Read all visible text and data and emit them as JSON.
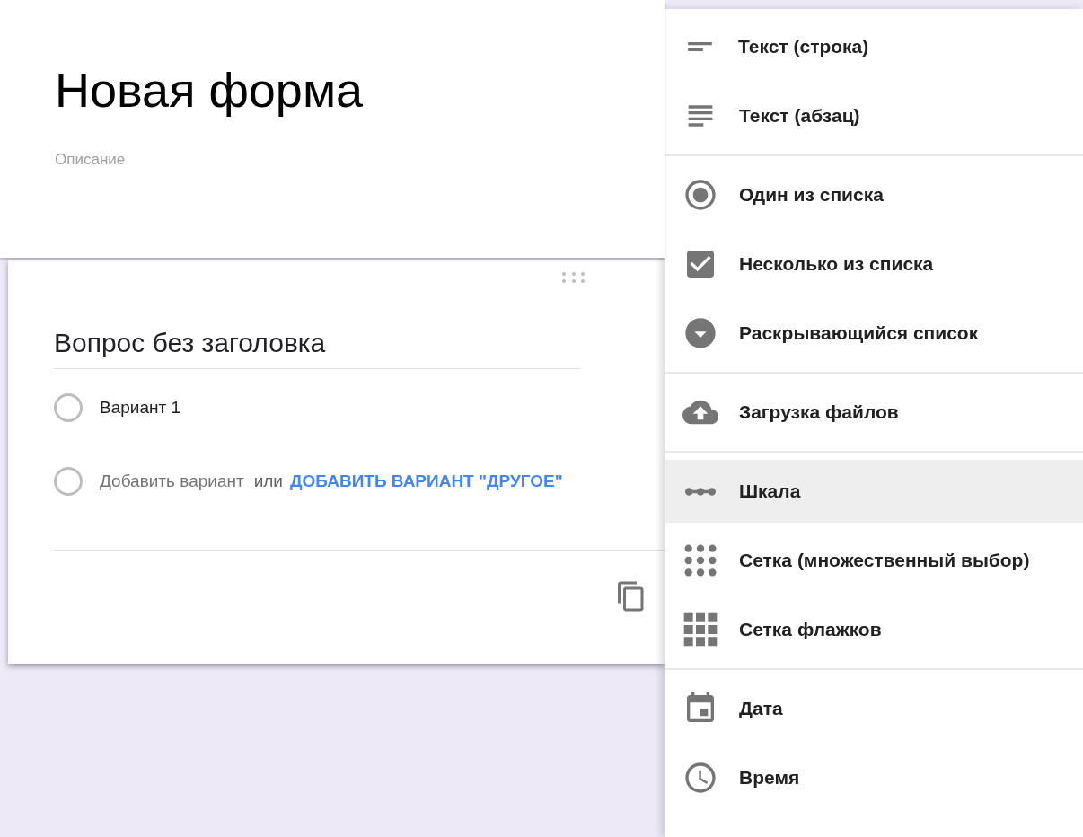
{
  "form": {
    "title": "Новая форма",
    "description": {
      "placeholder": "Описание"
    }
  },
  "question": {
    "title": "Вопрос без заголовка",
    "options": [
      {
        "label": "Вариант 1",
        "kind": "option",
        "selected": false
      },
      {
        "label": "Добавить вариант",
        "kind": "add",
        "selected": false
      }
    ],
    "or_text": "или",
    "add_other_link": "ДОБАВИТЬ ВАРИАНТ \"ДРУГОЕ\""
  },
  "type_menu": {
    "groups": [
      {
        "items": [
          {
            "label": "Текст (строка)",
            "kind": "short-text",
            "selected": false
          },
          {
            "label": "Текст (абзац)",
            "kind": "paragraph",
            "selected": false
          }
        ]
      },
      {
        "items": [
          {
            "label": "Один из списка",
            "kind": "radio",
            "selected": false
          },
          {
            "label": "Несколько из списка",
            "kind": "checkbox",
            "selected": false
          },
          {
            "label": "Раскрывающийся список",
            "kind": "dropdown",
            "selected": false
          }
        ]
      },
      {
        "items": [
          {
            "label": "Загрузка файлов",
            "kind": "upload",
            "selected": false
          }
        ]
      },
      {
        "items": [
          {
            "label": "Шкала",
            "kind": "scale",
            "selected": true
          },
          {
            "label": "Сетка (множественный выбор)",
            "kind": "dot-grid",
            "selected": false
          },
          {
            "label": "Сетка флажков",
            "kind": "square-grid",
            "selected": false
          }
        ]
      },
      {
        "items": [
          {
            "label": "Дата",
            "kind": "date",
            "selected": false
          },
          {
            "label": "Время",
            "kind": "time",
            "selected": false
          }
        ]
      }
    ]
  }
}
